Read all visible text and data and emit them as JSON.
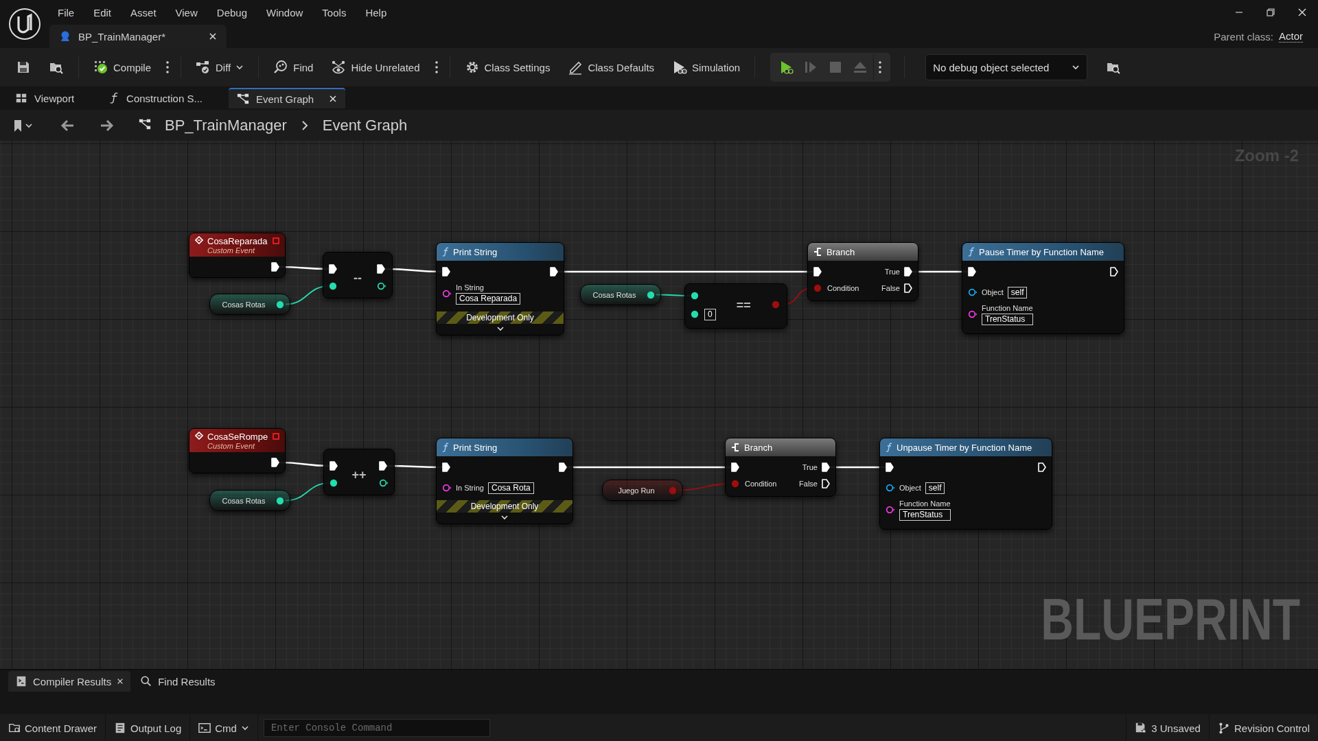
{
  "menu": [
    "File",
    "Edit",
    "Asset",
    "View",
    "Debug",
    "Window",
    "Tools",
    "Help"
  ],
  "document_tab": {
    "title": "BP_TrainManager*"
  },
  "parent_class": {
    "label": "Parent class:",
    "value": "Actor"
  },
  "toolbar": [
    [
      {
        "kind": "save"
      },
      {
        "kind": "browse"
      }
    ],
    [
      {
        "kind": "compile",
        "label": "Compile"
      },
      {
        "kind": "kebab"
      }
    ],
    [
      {
        "kind": "diff",
        "label": "Diff"
      }
    ],
    [
      {
        "kind": "find",
        "label": "Find"
      },
      {
        "kind": "hide_unrelated",
        "label": "Hide Unrelated"
      },
      {
        "kind": "kebab"
      }
    ],
    [
      {
        "kind": "class_settings",
        "label": "Class Settings"
      },
      {
        "kind": "class_defaults",
        "label": "Class Defaults"
      },
      {
        "kind": "simulation",
        "label": "Simulation"
      }
    ]
  ],
  "play_controls": [
    {
      "kind": "play",
      "disabled": false
    },
    {
      "kind": "advance",
      "disabled": true
    },
    {
      "kind": "stop",
      "disabled": true
    },
    {
      "kind": "eject",
      "disabled": true
    },
    {
      "kind": "kebab",
      "disabled": false
    }
  ],
  "debug_selector": {
    "value": "No debug object selected"
  },
  "graph_tabs": [
    {
      "kind": "viewport",
      "label": "Viewport",
      "selected": false
    },
    {
      "kind": "function",
      "label": "Construction S...",
      "selected": false
    },
    {
      "kind": "graph",
      "label": "Event Graph",
      "selected": true
    }
  ],
  "breadcrumb": [
    "BP_TrainManager",
    "Event Graph"
  ],
  "zoom_label": "Zoom -2",
  "graph_watermark": "BLUEPRINT",
  "nodes": [
    {
      "kind": "event",
      "title": "CosaReparada",
      "subtitle": "Custom Event"
    },
    {
      "kind": "operator",
      "symbol": "--"
    },
    {
      "kind": "variable",
      "label": "Cosas Rotas",
      "color": "#25dcae"
    },
    {
      "kind": "function",
      "title": "Print String",
      "then_linked": true,
      "inputs": [
        {
          "label": "In String",
          "value": "Cosa Reparada",
          "color": "#f03ae0",
          "kind": "stacked"
        }
      ],
      "dev_only": "Development Only"
    },
    {
      "kind": "variable",
      "label": "Cosas Rotas",
      "color": "#25dcae"
    },
    {
      "kind": "compare",
      "symbol": "==",
      "value": "0"
    },
    {
      "kind": "branch",
      "title": "Branch",
      "condition": "Condition",
      "true_label": "True",
      "false_label": "False"
    },
    {
      "kind": "function",
      "title": "Pause Timer by Function Name",
      "then_linked": false,
      "inputs": [
        {
          "label": "Object",
          "value": "self",
          "color": "#1aa6f0",
          "kind": "inline"
        },
        {
          "label": "Function Name",
          "value": "TrenStatus",
          "color": "#f03ae0",
          "kind": "stacked"
        }
      ]
    },
    {
      "kind": "event",
      "title": "CosaSeRompe",
      "subtitle": "Custom Event"
    },
    {
      "kind": "operator",
      "symbol": "++"
    },
    {
      "kind": "variable",
      "label": "Cosas Rotas",
      "color": "#25dcae"
    },
    {
      "kind": "function",
      "title": "Print String",
      "then_linked": true,
      "inputs": [
        {
          "label": "In String",
          "value": "Cosa Rota",
          "color": "#f03ae0",
          "kind": "inline"
        }
      ],
      "dev_only": "Development Only"
    },
    {
      "kind": "variable",
      "label": "Juego Run",
      "color": "#a00d0d"
    },
    {
      "kind": "branch",
      "title": "Branch",
      "condition": "Condition",
      "true_label": "True",
      "false_label": "False"
    },
    {
      "kind": "function",
      "title": "Unpause Timer by Function Name",
      "then_linked": false,
      "inputs": [
        {
          "label": "Object",
          "value": "self",
          "color": "#1aa6f0",
          "kind": "inline"
        },
        {
          "label": "Function Name",
          "value": "TrenStatus",
          "color": "#f03ae0",
          "kind": "stacked"
        }
      ]
    }
  ],
  "bottom_tabs": [
    {
      "kind": "compiler",
      "label": "Compiler Results",
      "selected": true
    },
    {
      "kind": "find",
      "label": "Find Results",
      "selected": false
    }
  ],
  "status_bar": {
    "left": [
      {
        "kind": "content_drawer",
        "label": "Content Drawer"
      },
      {
        "kind": "output_log",
        "label": "Output Log"
      },
      {
        "kind": "cmd",
        "label": "Cmd"
      }
    ],
    "console": {
      "placeholder": "Enter Console Command"
    },
    "right": [
      {
        "kind": "unsaved",
        "label": "3 Unsaved"
      },
      {
        "kind": "revision",
        "label": "Revision Control"
      }
    ]
  }
}
